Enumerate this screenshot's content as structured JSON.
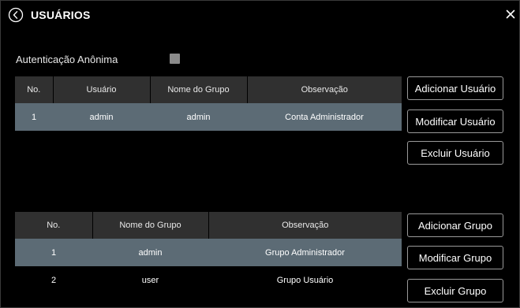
{
  "header": {
    "title": "USUÁRIOS",
    "back_icon": "circle-chevron-left-icon",
    "close_icon": "close-icon",
    "close_glyph": "×"
  },
  "anonymous_auth": {
    "label": "Autenticação Anônima",
    "checked": false
  },
  "users_table": {
    "columns": [
      "No.",
      "Usuário",
      "Nome do Grupo",
      "Observação"
    ],
    "rows": [
      {
        "no": "1",
        "user": "admin",
        "group": "admin",
        "note": "Conta Administrador",
        "selected": true
      }
    ]
  },
  "user_actions": {
    "add": "Adicionar Usuário",
    "modify": "Modificar Usuário",
    "delete": "Excluir Usuário"
  },
  "groups_table": {
    "columns": [
      "No.",
      "Nome do Grupo",
      "Observação"
    ],
    "rows": [
      {
        "no": "1",
        "group": "admin",
        "note": "Grupo Administrador",
        "selected": true
      },
      {
        "no": "2",
        "group": "user",
        "note": "Grupo Usuário",
        "selected": false
      }
    ]
  },
  "group_actions": {
    "add": "Adicionar Grupo",
    "modify": "Modificar Grupo",
    "delete": "Excluir Grupo"
  },
  "colors": {
    "background": "#000000",
    "header_cell": "#303030",
    "selected_row": "#5c6b75",
    "checkbox": "#8a8a8a",
    "button_border": "#9a9a9a"
  }
}
